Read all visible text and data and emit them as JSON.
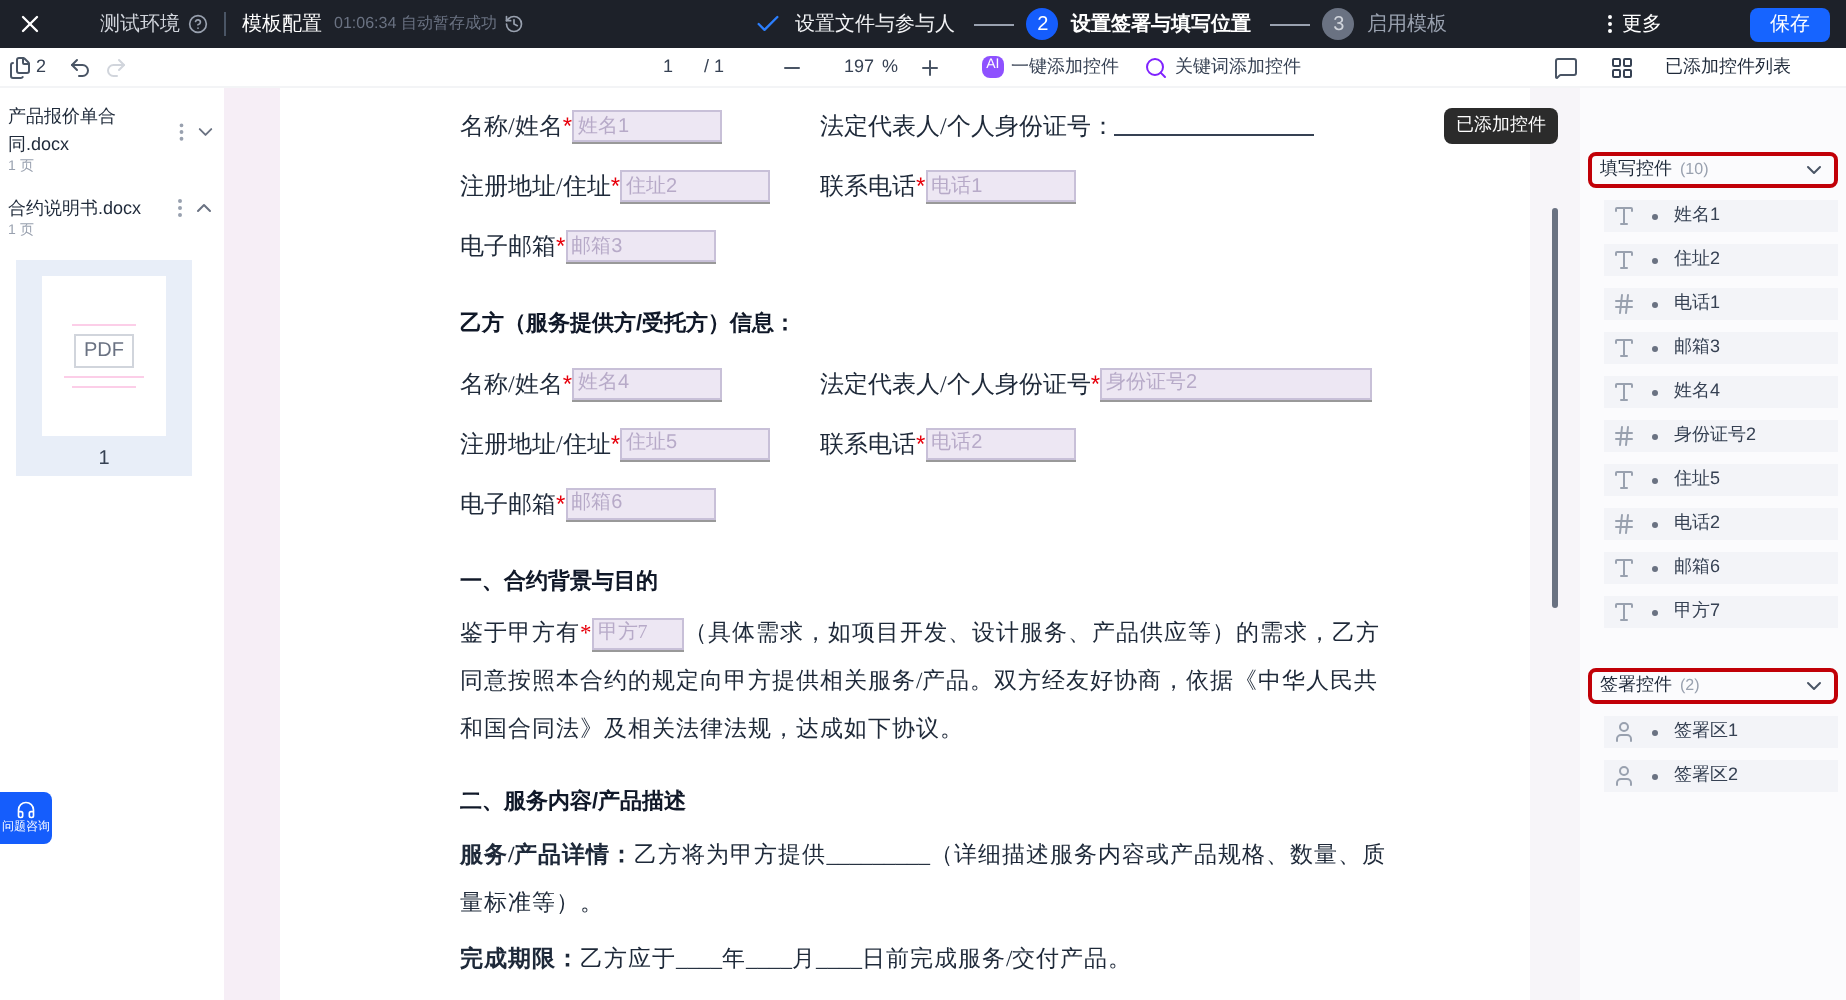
{
  "topbar": {
    "env": "测试环境",
    "title": "模板配置",
    "save_status": "01:06:34 自动暂存成功",
    "steps": [
      {
        "label": "设置文件与参与人",
        "completed": true,
        "current": false
      },
      {
        "number": "2",
        "label": "设置签署与填写位置",
        "completed": false,
        "current": true
      },
      {
        "number": "3",
        "label": "启用模板",
        "completed": false,
        "current": false
      }
    ],
    "more": "更多",
    "save": "保存"
  },
  "toolbar": {
    "file_count": "2",
    "page": "1",
    "page_total": "/ 1",
    "zoom": "197",
    "zoom_unit": "%",
    "ai_badge": "AI",
    "ai_add": "一键添加控件",
    "keyword_add": "关键词添加控件",
    "panel_title": "已添加控件列表",
    "tooltip": "已添加控件"
  },
  "files": [
    {
      "name": "产品报价单合同.docx",
      "pages": "1 页",
      "expanded": false
    },
    {
      "name": "合约说明书.docx",
      "pages": "1 页",
      "expanded": true,
      "thumbnail": {
        "label": "PDF",
        "page": "1"
      }
    }
  ],
  "document": [
    {
      "kind": "fields",
      "items": [
        {
          "label": "名称/姓名",
          "required_mark": "*",
          "placeholder": "姓名1"
        },
        {
          "label": "法定代表人/个人身份证号："
        }
      ]
    },
    {
      "kind": "fields",
      "items": [
        {
          "label": "注册地址/住址",
          "required_mark": "*",
          "placeholder": "住址2"
        },
        {
          "label": "联系电话",
          "required_mark": "*",
          "placeholder": "电话1"
        }
      ]
    },
    {
      "kind": "fields",
      "items": [
        {
          "label": "电子邮箱",
          "required_mark": "*",
          "placeholder": "邮箱3"
        }
      ]
    },
    {
      "kind": "heading",
      "text": "乙方（服务提供方/受托方）信息："
    },
    {
      "kind": "fields",
      "items": [
        {
          "label": "名称/姓名",
          "required_mark": "*",
          "placeholder": "姓名4"
        },
        {
          "label": "法定代表人/个人身份证号",
          "required_mark": "*",
          "placeholder": "身份证号2"
        }
      ]
    },
    {
      "kind": "fields",
      "items": [
        {
          "label": "注册地址/住址",
          "required_mark": "*",
          "placeholder": "住址5"
        },
        {
          "label": "联系电话",
          "required_mark": "*",
          "placeholder": "电话2"
        }
      ]
    },
    {
      "kind": "fields",
      "items": [
        {
          "label": "电子邮箱",
          "required_mark": "*",
          "placeholder": "邮箱6"
        }
      ]
    },
    {
      "kind": "heading",
      "text": "一、合约背景与目的"
    },
    {
      "kind": "paragraph",
      "segments": [
        {
          "kind": "text",
          "text": "鉴于甲方有"
        },
        {
          "kind": "field",
          "required_mark": "*",
          "placeholder": "甲方7"
        },
        {
          "kind": "text",
          "text": "（具体需求，如项目开发、设计服务、产品供应等）的需求，乙方同意按照本合约的规定向甲方提供相关服务/产品。双方经友好协商，依据《中华人民共和国合同法》及相关法律法规，达成如下协议。"
        }
      ]
    },
    {
      "kind": "heading",
      "text": "二、服务内容/产品描述"
    },
    {
      "kind": "paragraph",
      "segments": [
        {
          "kind": "text",
          "text": "**服务/产品详情：**乙方将为甲方提供_________（详细描述服务内容或产品规格、数量、质量标准等）。"
        }
      ]
    },
    {
      "kind": "paragraph",
      "segments": [
        {
          "kind": "text",
          "text": "**完成期限：**乙方应于____年____月____日前完成服务/交付产品。"
        }
      ]
    }
  ],
  "panel": {
    "groups": [
      {
        "title": "填写控件",
        "count": "(10)",
        "expanded": true,
        "highlighted": true,
        "items": [
          {
            "kind": "text",
            "label": "姓名1"
          },
          {
            "kind": "text",
            "label": "住址2"
          },
          {
            "kind": "number",
            "label": "电话1"
          },
          {
            "kind": "text",
            "label": "邮箱3"
          },
          {
            "kind": "text",
            "label": "姓名4"
          },
          {
            "kind": "number",
            "label": "身份证号2"
          },
          {
            "kind": "text",
            "label": "住址5"
          },
          {
            "kind": "number",
            "label": "电话2"
          },
          {
            "kind": "text",
            "label": "邮箱6"
          },
          {
            "kind": "text",
            "label": "甲方7"
          }
        ]
      },
      {
        "title": "签署控件",
        "count": "(2)",
        "expanded": true,
        "highlighted": true,
        "items": [
          {
            "kind": "signature",
            "label": "签署区1"
          },
          {
            "kind": "signature",
            "label": "签署区2"
          }
        ]
      }
    ]
  },
  "help": {
    "label": "问题咨询"
  }
}
